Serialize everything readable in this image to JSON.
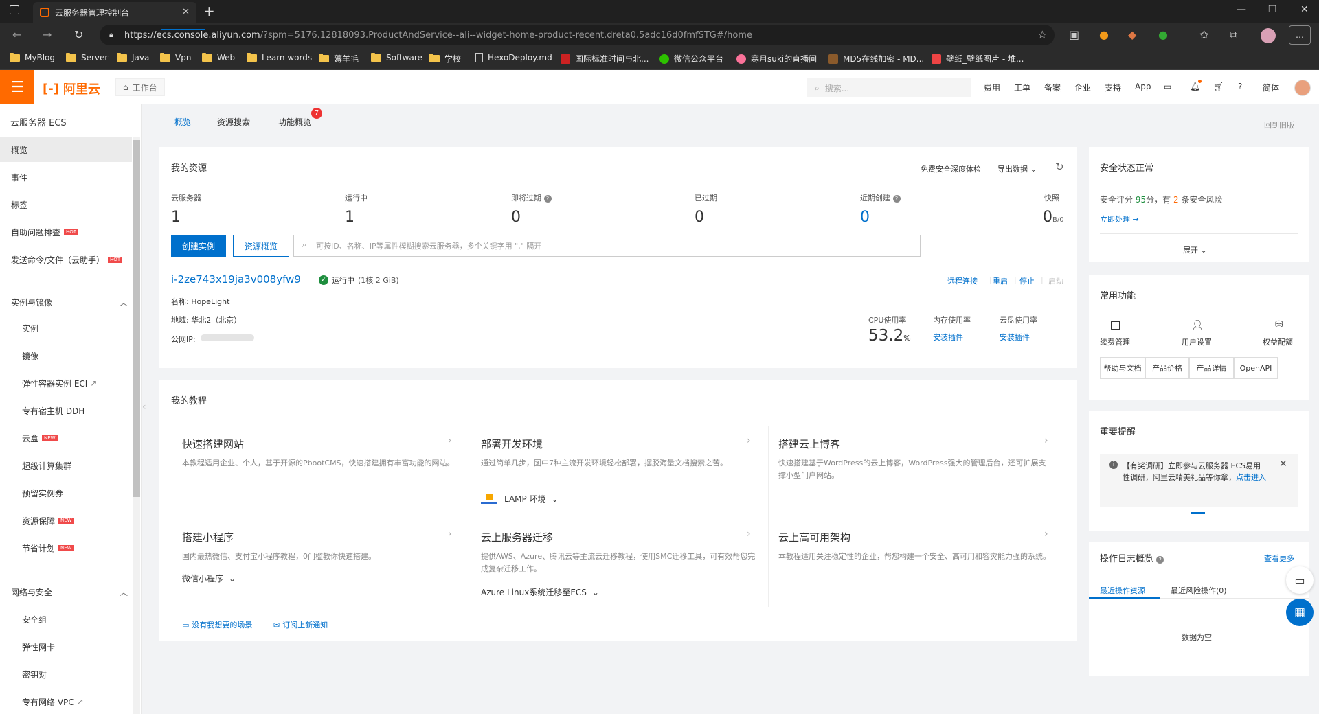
{
  "browser": {
    "tab_title": "云服务器管理控制台",
    "url_main": "https://ecs.console.aliyun.com",
    "url_rest": "/?spm=5176.12818093.ProductAndService--ali--widget-home-product-recent.dreta0.5adc16d0fmfSTG#/home",
    "bookmarks": [
      "MyBlog",
      "Server",
      "Java",
      "Vpn",
      "Web",
      "Learn words",
      "薅羊毛",
      "Software",
      "学校",
      "HexoDeploy.md",
      "国际标准时间与北...",
      "微信公众平台",
      "寒月suki的直播间",
      "MD5在线加密 - MD...",
      "壁纸_壁纸图片 - 堆..."
    ]
  },
  "topbar": {
    "logo": "阿里云",
    "workbench": "工作台",
    "search_placeholder": "搜索...",
    "nav": [
      "费用",
      "工单",
      "备案",
      "企业",
      "支持",
      "App"
    ],
    "lang": "简体"
  },
  "sidebar": {
    "title": "云服务器 ECS",
    "items_top": [
      "概览",
      "事件",
      "标签",
      "自助问题排查",
      "发送命令/文件（云助手）"
    ],
    "group1": "实例与镜像",
    "group1_items": [
      "实例",
      "镜像",
      "弹性容器实例 ECI",
      "专有宿主机 DDH",
      "云盒",
      "超级计算集群",
      "预留实例券",
      "资源保障",
      "节省计划"
    ],
    "group2": "网络与安全",
    "group2_items": [
      "安全组",
      "弹性网卡",
      "密钥对",
      "专有网络 VPC"
    ],
    "hot": "HOT",
    "new": "NEW"
  },
  "page_tabs": {
    "tabs": [
      "概览",
      "资源搜索",
      "功能概览"
    ],
    "badge": "7",
    "old_version": "回到旧版"
  },
  "resources": {
    "title": "我的资源",
    "free_check": "免费安全深度体检",
    "export": "导出数据",
    "stats": [
      {
        "label": "云服务器",
        "value": "1"
      },
      {
        "label": "运行中",
        "value": "1"
      },
      {
        "label": "即将过期",
        "value": "0"
      },
      {
        "label": "已过期",
        "value": "0"
      },
      {
        "label": "近期创建",
        "value": "0"
      },
      {
        "label": "快照",
        "value": "0"
      }
    ],
    "snapshot_unit": "B/0",
    "create_btn": "创建实例",
    "overview_btn": "资源概览",
    "search_placeholder": "可按ID、名称、IP等属性模糊搜索云服务器，多个关键字用 \",\" 隔开",
    "instance": {
      "id": "i-2ze743x19ja3v008yfw9",
      "status": "运行中",
      "spec": "(1核 2 GiB)",
      "name_label": "名称: ",
      "name": "HopeLight",
      "region_label": "地域: ",
      "region": "华北2（北京）",
      "ip_label": "公网IP: ",
      "actions": [
        "远程连接",
        "重启",
        "停止",
        "启动"
      ],
      "cpu_label": "CPU使用率",
      "cpu_value": "53.2",
      "cpu_unit": "%",
      "mem_label": "内存使用率",
      "mem_value": "安装插件",
      "disk_label": "云盘使用率",
      "disk_value": "安装插件"
    }
  },
  "tutorials": {
    "title": "我的教程",
    "items": [
      {
        "title": "快速搭建网站",
        "desc": "本教程适用企业、个人，基于开源的PbootCMS，快速搭建拥有丰富功能的网站。",
        "link": ""
      },
      {
        "title": "部署开发环境",
        "desc": "通过简单几步，图中7种主流开发环境轻松部署，摆脱海量文档搜索之苦。",
        "link": "LAMP 环境"
      },
      {
        "title": "搭建云上博客",
        "desc": "快速搭建基于WordPress的云上博客，WordPress强大的管理后台，还可扩展支撑小型门户网站。",
        "link": ""
      },
      {
        "title": "搭建小程序",
        "desc": "国内最热微信、支付宝小程序教程，0门槛教你快速搭建。",
        "link": "微信小程序"
      },
      {
        "title": "云上服务器迁移",
        "desc": "提供AWS、Azure、腾讯云等主流云迁移教程，使用SMC迁移工具，可有效帮您完成复杂迁移工作。",
        "link": "Azure Linux系统迁移至ECS"
      },
      {
        "title": "云上高可用架构",
        "desc": "本教程适用关注稳定性的企业，帮您构建一个安全、高可用和容灾能力强的系统。",
        "link": ""
      }
    ],
    "no_scene": "没有我想要的场景",
    "subscribe": "订阅上新通知"
  },
  "security": {
    "title": "安全状态正常",
    "score_prefix": "安全评分",
    "score": "95",
    "score_mid": "分，有",
    "risks": "2",
    "score_suffix": "条安全风险",
    "handle": "立即处理",
    "expand": "展开"
  },
  "common": {
    "title": "常用功能",
    "icons": [
      "续费管理",
      "用户设置",
      "权益配额"
    ],
    "buttons": [
      "帮助与文档",
      "产品价格",
      "产品详情",
      "OpenAPI"
    ]
  },
  "notice": {
    "title": "重要提醒",
    "text": "【有奖调研】立即参与云服务器 ECS易用性调研，阿里云精美礼品等你拿，",
    "link": "点击进入"
  },
  "oplog": {
    "title": "操作日志概览",
    "more": "查看更多",
    "tabs": [
      "最近操作资源",
      "最近风险操作(0)"
    ],
    "empty": "数据为空"
  },
  "colors": {
    "accent": "#0070cc",
    "brand": "#ff6a00",
    "success": "#1e8e3e"
  }
}
